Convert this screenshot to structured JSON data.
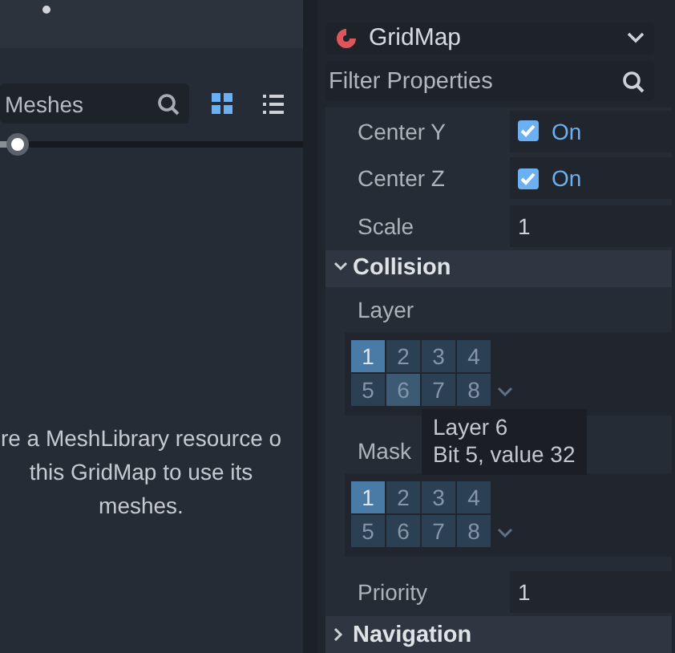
{
  "mesh_panel": {
    "search": {
      "value": "Meshes"
    },
    "view_modes": [
      {
        "kind": "grid",
        "selected": true
      },
      {
        "kind": "list",
        "selected": false
      }
    ],
    "zoom_slider": {
      "level": 0.06
    },
    "message": "re a MeshLibrary resource o this GridMap to use its meshes."
  },
  "inspector": {
    "node_type": "GridMap",
    "filter": {
      "placeholder": "Filter Properties"
    },
    "properties": [
      {
        "kind": "check",
        "label": "Center Y",
        "checked": true,
        "value": "On"
      },
      {
        "kind": "check",
        "label": "Center Z",
        "checked": true,
        "value": "On"
      },
      {
        "kind": "number",
        "label": "Scale",
        "value": "1"
      }
    ],
    "sections": [
      {
        "title": "Collision",
        "expanded": true,
        "properties": [
          {
            "kind": "layers",
            "label": "Layer",
            "cells": [
              {
                "label": "1",
                "selected": true,
                "hovered": false
              },
              {
                "label": "2",
                "selected": false,
                "hovered": false
              },
              {
                "label": "3",
                "selected": false,
                "hovered": false
              },
              {
                "label": "4",
                "selected": false,
                "hovered": false
              },
              {
                "label": "5",
                "selected": false,
                "hovered": false
              },
              {
                "label": "6",
                "selected": false,
                "hovered": true
              },
              {
                "label": "7",
                "selected": false,
                "hovered": false
              },
              {
                "label": "8",
                "selected": false,
                "hovered": false
              }
            ]
          },
          {
            "kind": "layers",
            "label": "Mask",
            "cells": [
              {
                "label": "1",
                "selected": true,
                "hovered": false
              },
              {
                "label": "2",
                "selected": false,
                "hovered": false
              },
              {
                "label": "3",
                "selected": false,
                "hovered": false
              },
              {
                "label": "4",
                "selected": false,
                "hovered": false
              },
              {
                "label": "5",
                "selected": false,
                "hovered": false
              },
              {
                "label": "6",
                "selected": false,
                "hovered": false
              },
              {
                "label": "7",
                "selected": false,
                "hovered": false
              },
              {
                "label": "8",
                "selected": false,
                "hovered": false
              }
            ]
          },
          {
            "kind": "number",
            "label": "Priority",
            "value": "1"
          }
        ]
      },
      {
        "title": "Navigation",
        "expanded": false
      }
    ]
  },
  "tooltip": {
    "lines": [
      "Layer 6",
      "Bit 5, value 32"
    ]
  }
}
